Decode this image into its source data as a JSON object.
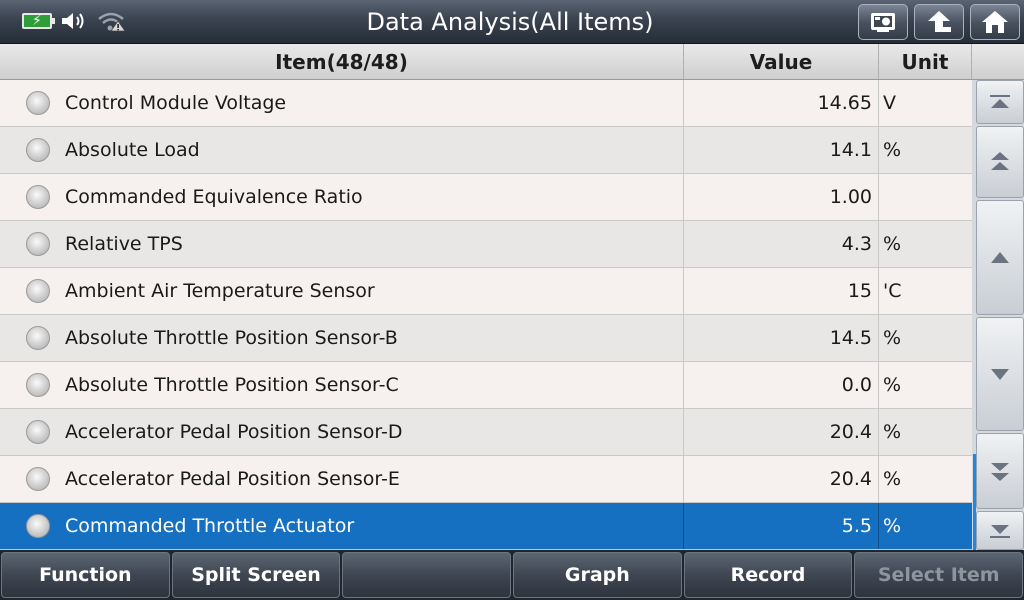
{
  "window": {
    "title": "Data Analysis(All Items)"
  },
  "top_buttons": [
    {
      "icon": "screenshot-icon"
    },
    {
      "icon": "back-arrow-icon"
    },
    {
      "icon": "home-icon"
    }
  ],
  "table": {
    "columns": {
      "item": "Item(48/48)",
      "value": "Value",
      "unit": "Unit"
    },
    "rows": [
      {
        "name": "Control Module Voltage",
        "value": "14.65",
        "unit": "V"
      },
      {
        "name": "Absolute Load",
        "value": "14.1",
        "unit": "%"
      },
      {
        "name": "Commanded Equivalence Ratio",
        "value": "1.00",
        "unit": ""
      },
      {
        "name": "Relative TPS",
        "value": "4.3",
        "unit": "%"
      },
      {
        "name": "Ambient Air Temperature Sensor",
        "value": "15",
        "unit": "'C"
      },
      {
        "name": "Absolute Throttle Position Sensor-B",
        "value": "14.5",
        "unit": "%"
      },
      {
        "name": "Absolute Throttle Position Sensor-C",
        "value": "0.0",
        "unit": "%"
      },
      {
        "name": "Accelerator Pedal Position Sensor-D",
        "value": "20.4",
        "unit": "%"
      },
      {
        "name": "Accelerator Pedal Position Sensor-E",
        "value": "20.4",
        "unit": "%"
      },
      {
        "name": "Commanded Throttle Actuator",
        "value": "5.5",
        "unit": "%",
        "selected": true
      }
    ]
  },
  "bottom_bar": {
    "function": "Function",
    "split_screen": "Split Screen",
    "empty": "",
    "graph": "Graph",
    "record": "Record",
    "select_item": "Select Item"
  },
  "colors": {
    "selected_row": "#1670c2",
    "battery": "#2f9e3a",
    "scroll_indicator": "#1e88e5"
  }
}
